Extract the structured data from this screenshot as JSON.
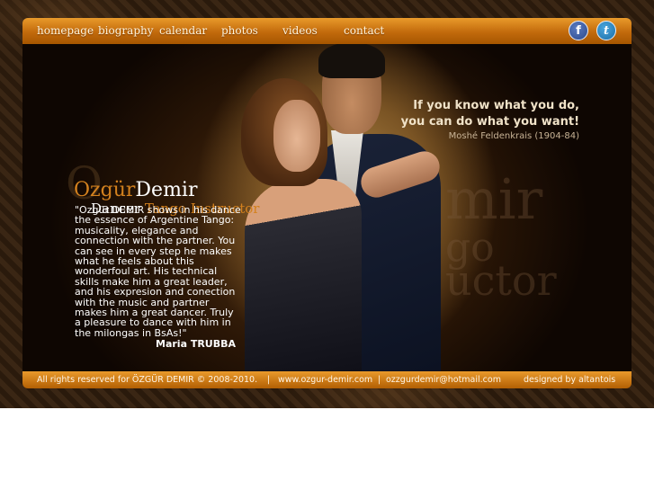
{
  "nav": {
    "items": [
      "homepage",
      "biography",
      "calendar",
      "photos",
      "videos",
      "contact"
    ]
  },
  "social": {
    "facebook_glyph": "f",
    "twitter_glyph": "t",
    "icons": [
      "facebook-icon",
      "twitter-icon"
    ]
  },
  "hero": {
    "background_words": [
      "mir",
      "go",
      "uctor",
      "O"
    ],
    "quote": {
      "line1": "If you know what you do,",
      "line2": "you can do what you want!",
      "author": "Moshé Feldenkrais (1904-84)"
    },
    "brand": {
      "first": "Ozgür",
      "last": "Demir",
      "role1": "Dancer",
      "role2": "Tango Instructor"
    },
    "testimonial": {
      "text": "\"Ozgür DEMIR shows in his dance the essence of Argentine Tango: musicality, elegance and connection with the partner. You can see in every step he makes what he feels about this wonderfoul art. His technical skills make him a great leader, and his expresion and conection with the music and partner makes him a great dancer. Truly a pleasure to dance with him in the milongas in BsAs!\"",
      "author": "Maria TRUBBA"
    }
  },
  "footer": {
    "rights": "All rights reserved for ÖZGÜR DEMIR © 2008-2010.",
    "sep1": "|",
    "website": "www.ozgur-demir.com",
    "sep2": "|",
    "email": "ozzgurdemir@hotmail.com",
    "credit": "designed by altantois"
  },
  "colors": {
    "bar_orange": "#c26a0c",
    "brand_orange": "#d3811e",
    "facebook": "#2d4a8c",
    "twitter": "#1d6fa8"
  }
}
